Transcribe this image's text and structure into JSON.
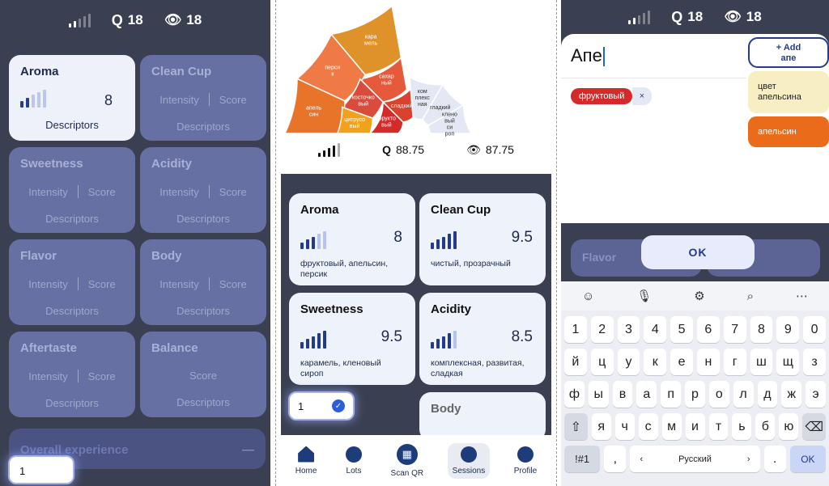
{
  "panel1": {
    "status": {
      "q_score": "18",
      "view_score": "18"
    },
    "cards": [
      {
        "title": "Aroma",
        "score": "8",
        "descriptors": "Descriptors",
        "active": true
      },
      {
        "title": "Clean Cup",
        "intensity": "Intensity",
        "score_label": "Score",
        "descriptors": "Descriptors"
      },
      {
        "title": "Sweetness",
        "intensity": "Intensity",
        "score_label": "Score",
        "descriptors": "Descriptors"
      },
      {
        "title": "Acidity",
        "intensity": "Intensity",
        "score_label": "Score",
        "descriptors": "Descriptors"
      },
      {
        "title": "Flavor",
        "intensity": "Intensity",
        "score_label": "Score",
        "descriptors": "Descriptors"
      },
      {
        "title": "Body",
        "intensity": "Intensity",
        "score_label": "Score",
        "descriptors": "Descriptors"
      },
      {
        "title": "Aftertaste",
        "intensity": "Intensity",
        "score_label": "Score",
        "descriptors": "Descriptors"
      },
      {
        "title": "Balance",
        "score_label": "Score",
        "descriptors": "Descriptors"
      }
    ],
    "overall": "Overall experience",
    "overall_sign": "—",
    "input_value": "1"
  },
  "panel2": {
    "wheel_labels": [
      "кара мель",
      "сахар ный",
      "перси к",
      "косточко вый",
      "апель син",
      "цитрусо вый",
      "фрукто вый",
      "сладкий",
      "ком плекс ная",
      "гладкий",
      "клено вый си роп"
    ],
    "status": {
      "q_score": "88.75",
      "view_score": "87.75"
    },
    "cards": [
      {
        "title": "Aroma",
        "score": "8",
        "desc": "фруктовый, апельсин, персик",
        "level": 3
      },
      {
        "title": "Clean Cup",
        "score": "9.5",
        "desc": "чистый, прозрачный",
        "level": 5
      },
      {
        "title": "Sweetness",
        "score": "9.5",
        "desc": "карамель, кленовый сироп",
        "level": 5
      },
      {
        "title": "Acidity",
        "score": "8.5",
        "desc": "комплексная, развитая, сладкая",
        "level": 4
      },
      {
        "title": "Body"
      }
    ],
    "input_value": "1",
    "nav": [
      "Home",
      "Lots",
      "Scan QR",
      "Sessions",
      "Profile"
    ]
  },
  "panel3": {
    "status": {
      "q_score": "18",
      "view_score": "18"
    },
    "input_text": "Апе",
    "chip": "фруктовый",
    "chip_remove": "×",
    "add_line1": "+ Add",
    "add_line2": "апе",
    "suggestion1": "цвет апельсина",
    "suggestion2": "апельсин",
    "bg_row": "Flavor",
    "ok": "OK",
    "keyboard": {
      "row0": [
        "1",
        "2",
        "3",
        "4",
        "5",
        "6",
        "7",
        "8",
        "9",
        "0"
      ],
      "row1": [
        "й",
        "ц",
        "у",
        "к",
        "е",
        "н",
        "г",
        "ш",
        "щ",
        "з"
      ],
      "row2": [
        "ф",
        "ы",
        "в",
        "а",
        "п",
        "р",
        "о",
        "л",
        "д",
        "ж",
        "э"
      ],
      "row3": [
        "я",
        "ч",
        "с",
        "м",
        "и",
        "т",
        "ь",
        "б",
        "ю"
      ],
      "sym": "!#1",
      "lang": "Русский",
      "comma": ",",
      "period": ".",
      "ok": "OK",
      "shift": "⇧",
      "backspace": "⌫",
      "left": "‹",
      "right": "›"
    }
  }
}
